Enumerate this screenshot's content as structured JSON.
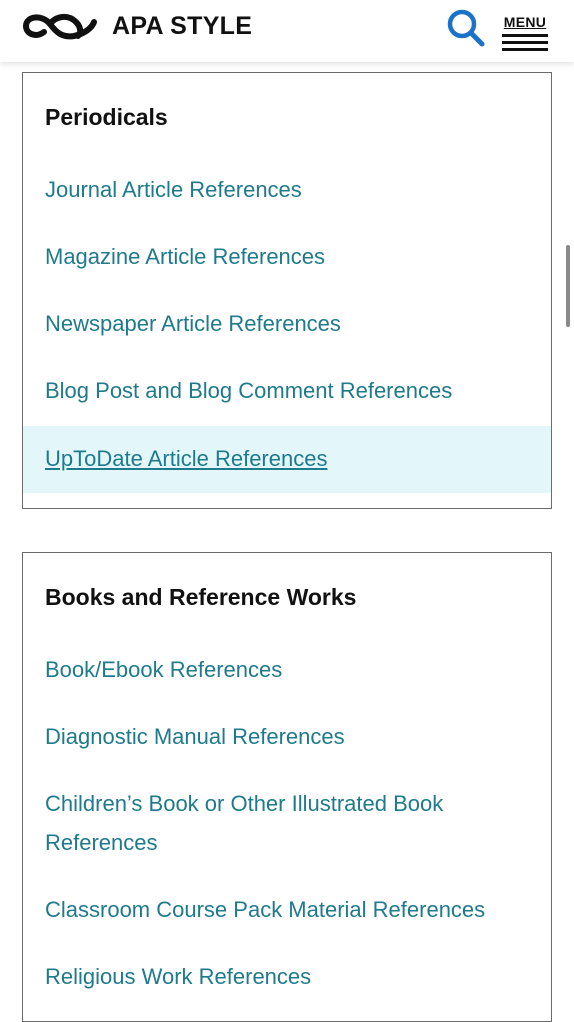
{
  "header": {
    "brand": "APA STYLE",
    "menu_label": "MENU"
  },
  "sections": [
    {
      "title": "Periodicals",
      "links": [
        "Journal Article References",
        "Magazine Article References",
        "Newspaper Article References",
        "Blog Post and Blog Comment References",
        "UpToDate Article References"
      ]
    },
    {
      "title": "Books and Reference Works",
      "links": [
        "Book/Ebook References",
        "Diagnostic Manual References",
        "Children’s Book or Other Illustrated Book",
        "References",
        "Classroom Course Pack Material References",
        "Religious Work References"
      ]
    }
  ],
  "colors": {
    "link": "#1f7a8c",
    "active_bg": "#e3f7fb",
    "search_icon": "#1a73c9"
  }
}
